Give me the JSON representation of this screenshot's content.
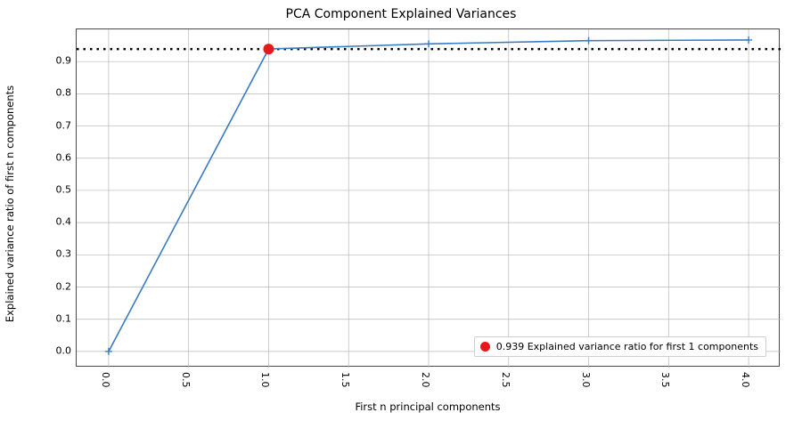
{
  "chart_data": {
    "type": "line",
    "title": "PCA Component Explained Variances",
    "xlabel": "First n principal components",
    "ylabel": "Explained variance ratio of first n components",
    "x": [
      0,
      1,
      2,
      3,
      4
    ],
    "y": [
      0.0,
      0.939,
      0.955,
      0.965,
      0.967
    ],
    "xlim": [
      -0.2,
      4.2
    ],
    "ylim": [
      -0.05,
      1.0
    ],
    "xticks": [
      0.0,
      0.5,
      1.0,
      1.5,
      2.0,
      2.5,
      3.0,
      3.5,
      4.0
    ],
    "xtick_labels": [
      "0.0",
      "0.5",
      "1.0",
      "1.5",
      "2.0",
      "2.5",
      "3.0",
      "3.5",
      "4.0"
    ],
    "yticks": [
      0.0,
      0.1,
      0.2,
      0.3,
      0.4,
      0.5,
      0.6,
      0.7,
      0.8,
      0.9
    ],
    "ytick_labels": [
      "0.0",
      "0.1",
      "0.2",
      "0.3",
      "0.4",
      "0.5",
      "0.6",
      "0.7",
      "0.8",
      "0.9"
    ],
    "threshold": 0.939,
    "highlight_point": {
      "x": 1,
      "y": 0.939
    },
    "legend": {
      "text": "0.939 Explained variance ratio for first 1 components",
      "marker": "red-dot"
    },
    "line_color": "#3a7cc0",
    "marker_style": "plus",
    "marker_color": "#3a7cc0",
    "highlight_color": "#e41a1c"
  }
}
